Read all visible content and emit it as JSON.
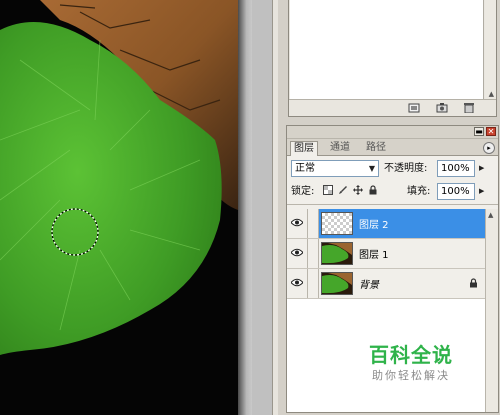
{
  "layers_panel": {
    "tabs": [
      "图层",
      "通道",
      "路径"
    ],
    "blend_mode": "正常",
    "opacity_label": "不透明度:",
    "opacity_value": "100%",
    "lock_label": "锁定:",
    "fill_label": "填充:",
    "fill_value": "100%",
    "layers": [
      {
        "name": "图层 2",
        "selected": true,
        "visible": true
      },
      {
        "name": "图层 1",
        "selected": false,
        "visible": true
      },
      {
        "name": "背景",
        "selected": false,
        "visible": true,
        "locked": true
      }
    ]
  },
  "icons": [
    "eye-icon",
    "lock-icon",
    "brush-icon",
    "move-icon",
    "panel-menu-icon",
    "close-icon",
    "minimize-icon",
    "new-snapshot-icon",
    "camera-icon",
    "trash-icon"
  ],
  "colors": {
    "selection": "#3b8fe6",
    "leaf": "#4fae2c",
    "watermark_green": "#2fb34a"
  },
  "watermark": {
    "title": "百科全说",
    "subtitle": "助你轻松解决"
  }
}
